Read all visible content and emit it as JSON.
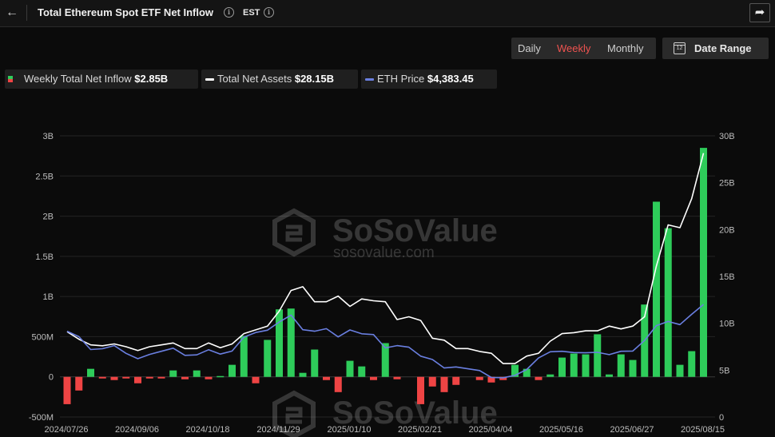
{
  "header": {
    "back_icon": "arrow-left-icon",
    "title": "Total Ethereum Spot ETF Net Inflow",
    "timezone": "EST",
    "share_icon": "share-arrow-icon"
  },
  "controls": {
    "periods": [
      "Daily",
      "Weekly",
      "Monthly"
    ],
    "active_period": "Weekly",
    "date_range_label": "Date Range",
    "calendar_icon": "calendar-icon",
    "active_color": "#ef5350"
  },
  "legend": [
    {
      "label": "Weekly Total Net Inflow",
      "value": "$2.85B"
    },
    {
      "label": "Total Net Assets",
      "value": "$28.15B"
    },
    {
      "label": "ETH Price",
      "value": "$4,383.45"
    }
  ],
  "watermark": {
    "brand": "SoSoValue",
    "url": "sosovalue.com"
  },
  "chart_data": {
    "type": "bar",
    "title": "Total Ethereum Spot ETF Net Inflow",
    "y_left_ticks": [
      "-500M",
      "0",
      "500M",
      "1B",
      "1.5B",
      "2B",
      "2.5B",
      "3B"
    ],
    "y_left_range": [
      -0.5,
      3.0
    ],
    "y_right_ticks": [
      "0",
      "5B",
      "10B",
      "15B",
      "20B",
      "25B",
      "30B"
    ],
    "y_right_range": [
      0,
      30
    ],
    "x_tick_labels": [
      "2024/07/26",
      "2024/09/06",
      "2024/10/18",
      "2024/11/29",
      "2025/01/10",
      "2025/02/21",
      "2025/04/04",
      "2025/05/16",
      "2025/06/27",
      "2025/08/15"
    ],
    "grid": true,
    "colors": {
      "positive": "#2ecc5a",
      "negative": "#ef4444",
      "total_net_assets": "#ffffff",
      "eth_price": "#6a7fe0"
    },
    "series": [
      {
        "name": "Weekly Total Net Inflow",
        "unit": "B USD",
        "values": [
          -0.34,
          -0.17,
          0.1,
          -0.02,
          -0.04,
          -0.02,
          -0.08,
          -0.02,
          -0.02,
          0.08,
          -0.03,
          0.08,
          -0.03,
          0.01,
          0.15,
          0.51,
          -0.08,
          0.46,
          0.84,
          0.85,
          0.05,
          0.34,
          -0.04,
          -0.19,
          0.2,
          0.13,
          -0.04,
          0.42,
          -0.03,
          0.0,
          -0.34,
          -0.12,
          -0.19,
          -0.1,
          0.0,
          -0.04,
          -0.07,
          -0.04,
          0.15,
          0.1,
          -0.04,
          0.03,
          0.24,
          0.29,
          0.28,
          0.53,
          0.03,
          0.28,
          0.21,
          0.9,
          2.18,
          1.85,
          0.15,
          0.32,
          2.85
        ]
      },
      {
        "name": "Total Net Assets",
        "unit": "B USD",
        "values": [
          9.1,
          8.3,
          7.7,
          7.6,
          7.8,
          7.5,
          7.1,
          7.5,
          7.7,
          7.9,
          7.3,
          7.3,
          7.9,
          7.4,
          7.8,
          8.9,
          9.3,
          9.7,
          11.3,
          13.5,
          13.9,
          12.3,
          12.3,
          12.9,
          11.8,
          12.6,
          12.4,
          12.3,
          10.4,
          10.7,
          10.3,
          8.4,
          8.2,
          7.3,
          7.3,
          7.0,
          6.8,
          5.7,
          5.7,
          6.5,
          6.8,
          8.1,
          8.9,
          9.0,
          9.2,
          9.2,
          9.7,
          9.4,
          9.7,
          10.7,
          16.1,
          20.5,
          20.2,
          23.3,
          28.15
        ]
      },
      {
        "name": "ETH Price",
        "unit": "USD",
        "values": [
          3340,
          3130,
          2630,
          2660,
          2780,
          2480,
          2270,
          2440,
          2560,
          2680,
          2400,
          2420,
          2620,
          2450,
          2570,
          3110,
          3290,
          3380,
          3700,
          3970,
          3400,
          3340,
          3440,
          3120,
          3390,
          3240,
          3210,
          2690,
          2780,
          2720,
          2370,
          2240,
          1910,
          1950,
          1880,
          1810,
          1540,
          1530,
          1620,
          1850,
          2300,
          2540,
          2560,
          2510,
          2500,
          2520,
          2430,
          2560,
          2570,
          2980,
          3560,
          3720,
          3600,
          4000,
          4383.45
        ]
      }
    ]
  }
}
